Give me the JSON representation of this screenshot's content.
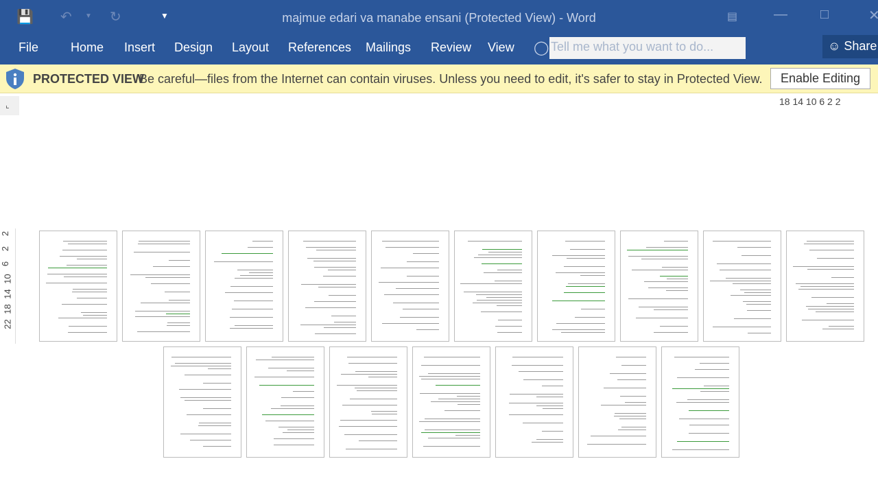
{
  "window": {
    "title": "majmue edari va manabe ensani (Protected View) - Word"
  },
  "quick_access": {
    "save_icon": "save-icon",
    "undo_icon": "undo-icon",
    "redo_icon": "redo-icon",
    "customize_icon": "dropdown-icon"
  },
  "ribbon": {
    "tabs": [
      {
        "label": "File"
      },
      {
        "label": "Home"
      },
      {
        "label": "Insert"
      },
      {
        "label": "Design"
      },
      {
        "label": "Layout"
      },
      {
        "label": "References"
      },
      {
        "label": "Mailings"
      },
      {
        "label": "Review"
      },
      {
        "label": "View"
      }
    ],
    "tell_me_placeholder": "Tell me what you want to do...",
    "share_label": "Share"
  },
  "protected_view": {
    "label": "PROTECTED VIEW",
    "message": "Be careful—files from the Internet can contain viruses. Unless you need to edit, it's safer to stay in Protected View.",
    "button": "Enable Editing",
    "color": "#fdf6b9"
  },
  "ruler": {
    "horizontal": "18 14 10 6 2 2",
    "vertical": [
      "2",
      "2",
      "6",
      "10",
      "14",
      "18",
      "22"
    ]
  },
  "document": {
    "page_count": 17,
    "rows": [
      10,
      7
    ]
  },
  "colors": {
    "brand": "#2b579a"
  }
}
